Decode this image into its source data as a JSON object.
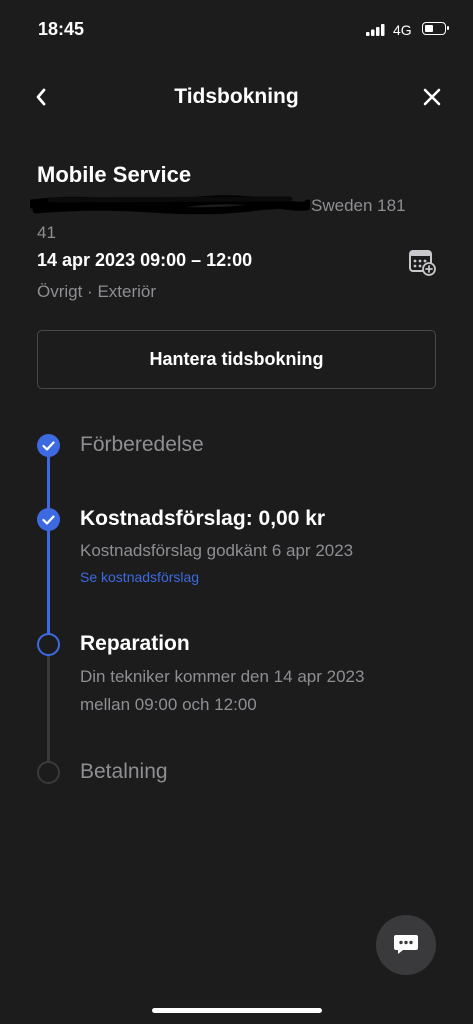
{
  "status_bar": {
    "time": "18:45",
    "network": "4G",
    "battery_level": 0.45
  },
  "nav": {
    "title": "Tidsbokning",
    "back_icon": "chevron-left-icon",
    "close_icon": "close-icon"
  },
  "booking": {
    "service_title": "Mobile Service",
    "address_line1": "Sweden 181",
    "address_line2": "41",
    "datetime": "14 apr 2023 09:00 – 12:00",
    "category": "Övrigt · Exteriör",
    "calendar_icon": "calendar-add-icon",
    "manage_button": "Hantera tidsbokning"
  },
  "timeline": {
    "steps": [
      {
        "label": "Förberedelse",
        "state": "done"
      },
      {
        "label": "Kostnadsförslag: 0,00 kr",
        "state": "done",
        "detail": "Kostnadsförslag godkänt 6 apr 2023",
        "link": "Se kostnadsförslag"
      },
      {
        "label": "Reparation",
        "state": "current",
        "detail_line1": "Din tekniker kommer den 14 apr 2023",
        "detail_line2": "mellan 09:00 och 12:00"
      },
      {
        "label": "Betalning",
        "state": "pending"
      }
    ]
  },
  "chat_icon": "chat-bubble-icon",
  "colors": {
    "accent": "#3e6ae1",
    "background": "#1c1c1d",
    "muted": "#8e8e93"
  }
}
